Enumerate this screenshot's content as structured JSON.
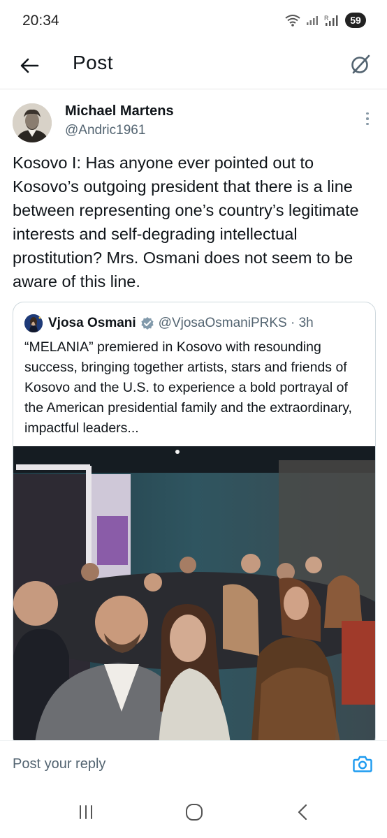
{
  "status_bar": {
    "time": "20:34",
    "battery": "59"
  },
  "header": {
    "title": "Post",
    "back_icon": "arrow-left-icon",
    "grok_icon": "slashed-circle-icon"
  },
  "post": {
    "author": {
      "name": "Michael Martens",
      "handle": "@Andric1961"
    },
    "text": "Kosovo I: Has anyone ever pointed out to Kosovo’s outgoing president that there is a line between representing one’s country’s legitimate interests and self-degrading intellectual prostitution? Mrs. Osmani does not seem to be aware of this line."
  },
  "quote": {
    "name": "Vjosa Osmani",
    "handle": "@VjosaOsmaniPRKS · 3h",
    "text": "“MELANIA” premiered in Kosovo with resounding success, bringing together artists, stars and friends of Kosovo and the U.S. to experience a bold portrayal of the American presidential family and the extraordinary, impactful leaders...",
    "verified_badge_color": "#829aab"
  },
  "reply": {
    "placeholder": "Post your reply"
  },
  "colors": {
    "accent": "#1d9bf0",
    "text": "#0f1419",
    "secondary": "#536471"
  }
}
